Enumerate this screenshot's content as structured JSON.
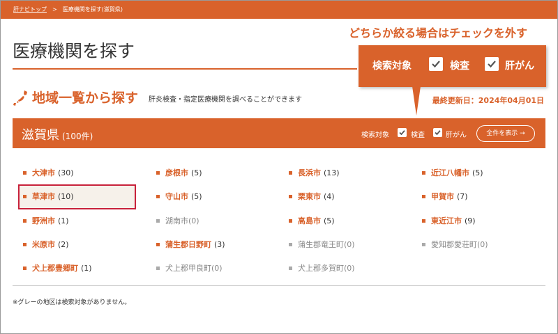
{
  "breadcrumb": {
    "home": "肝ナビトップ",
    "separator": ">",
    "current": "医療機関を探す(滋賀県)"
  },
  "page_title": "医療機関を探す",
  "annotation": {
    "text": "どちらか絞る場合はチェックを外す",
    "callout_label": "検索対象",
    "options": [
      {
        "label": "検査",
        "checked": true
      },
      {
        "label": "肝がん",
        "checked": true
      }
    ]
  },
  "region": {
    "title": "地域一覧から探す",
    "description": "肝炎検査・指定医療機関を調べることができます",
    "updated": "最終更新日：2024年04月01日"
  },
  "prefecture": {
    "name": "滋賀県",
    "count": "(100件)",
    "filter_label": "検索対象",
    "filters": [
      {
        "label": "検査",
        "checked": true
      },
      {
        "label": "肝がん",
        "checked": true
      }
    ],
    "show_all": "全件を表示 →"
  },
  "cities": [
    {
      "name": "大津市",
      "count": "(30)",
      "active": true
    },
    {
      "name": "彦根市",
      "count": "(5)",
      "active": true
    },
    {
      "name": "長浜市",
      "count": "(13)",
      "active": true
    },
    {
      "name": "近江八幡市",
      "count": "(5)",
      "active": true
    },
    {
      "name": "草津市",
      "count": "(10)",
      "active": true
    },
    {
      "name": "守山市",
      "count": "(5)",
      "active": true
    },
    {
      "name": "栗東市",
      "count": "(4)",
      "active": true
    },
    {
      "name": "甲賀市",
      "count": "(7)",
      "active": true
    },
    {
      "name": "野洲市",
      "count": "(1)",
      "active": true
    },
    {
      "name": "湖南市",
      "count": "(0)",
      "active": false
    },
    {
      "name": "高島市",
      "count": "(5)",
      "active": true
    },
    {
      "name": "東近江市",
      "count": "(9)",
      "active": true
    },
    {
      "name": "米原市",
      "count": "(2)",
      "active": true
    },
    {
      "name": "蒲生郡日野町",
      "count": "(3)",
      "active": true
    },
    {
      "name": "蒲生郡竜王町",
      "count": "(0)",
      "active": false
    },
    {
      "name": "愛知郡愛荘町",
      "count": "(0)",
      "active": false
    },
    {
      "name": "犬上郡豊郷町",
      "count": "(1)",
      "active": true
    },
    {
      "name": "犬上郡甲良町",
      "count": "(0)",
      "active": false
    },
    {
      "name": "犬上郡多賀町",
      "count": "(0)",
      "active": false
    }
  ],
  "note": "※グレーの地区は検索対象がありません。",
  "colors": {
    "accent": "#d9622b",
    "highlight": "#c8213a",
    "inactive": "#888888"
  }
}
